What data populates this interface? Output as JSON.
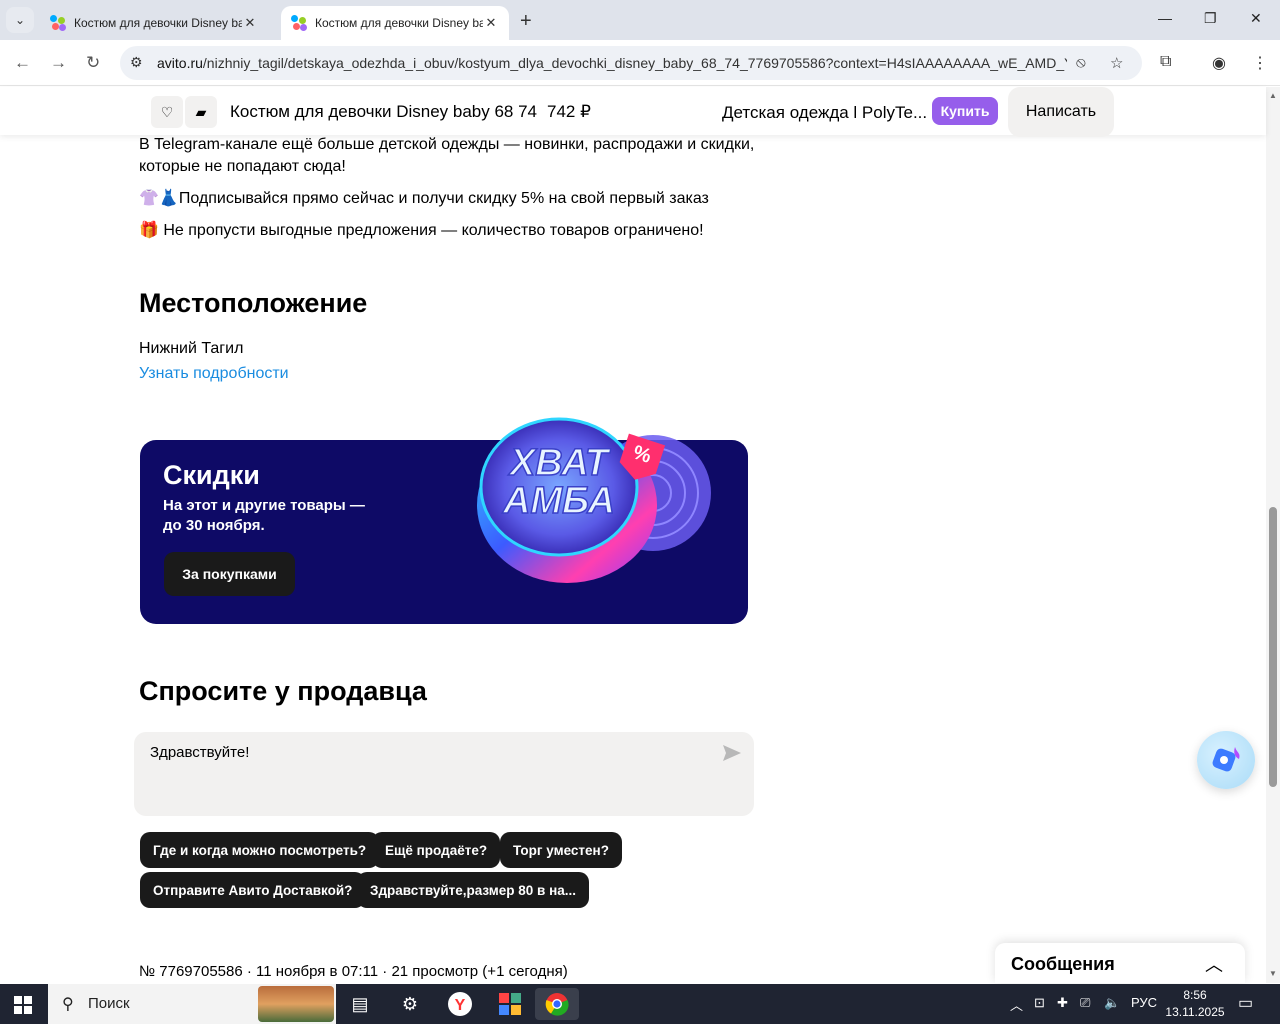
{
  "browser": {
    "tabs": [
      {
        "title": "Костюм для девочки Disney baby 68 74",
        "active": false
      },
      {
        "title": "Костюм для девочки Disney baby 68 74",
        "active": true
      }
    ],
    "url_host": "avito.ru",
    "url_path": "/nizhniy_tagil/detskaya_odezhda_i_obuv/kostyum_dlya_devochki_disney_baby_68_74_7769705586?context=H4sIAAAAAAAA_wE_AMD_YTo..."
  },
  "sticky": {
    "title": "Костюм для девочки Disney baby 68 74",
    "price": "742 ₽",
    "seller": "Детская одежда l PolyTe...",
    "buy_label": "Купить",
    "write_label": "Написать"
  },
  "description": {
    "line1": "В Telegram-канале ещё больше детской одежды — новинки, распродажи и скидки, которые не попадают сюда!",
    "line2": "👚👗Подписывайся прямо сейчас и получи скидку 5% на свой первый заказ",
    "line3": "🎁 Не пропусти выгодные предложения — количество товаров ограничено!"
  },
  "location": {
    "heading": "Местоположение",
    "city": "Нижний Тагил",
    "details_link": "Узнать подробности"
  },
  "banner": {
    "title": "Скидки",
    "text": "На этот и другие товары — до 30 ноября.",
    "button": "За покупками",
    "art_text_1": "ХВАТ",
    "art_text_2": "АМБА",
    "colors": {
      "bg": "#0e0a66"
    }
  },
  "ask_seller": {
    "heading": "Спросите у продавца",
    "message_value": "Здравствуйте!",
    "chips": [
      "Где и когда можно посмотреть?",
      "Ещё продаёте?",
      "Торг уместен?",
      "Отправите Авито Доставкой?",
      "Здравствуйте,размер 80 в на..."
    ]
  },
  "meta": "№ 7769705586 · 11 ноября в 07:11 · 21 просмотр (+1 сегодня)",
  "messages_panel": {
    "title": "Сообщения"
  },
  "taskbar": {
    "search_placeholder": "Поиск",
    "lang": "РУС",
    "time": "8:56",
    "date": "13.11.2025"
  }
}
